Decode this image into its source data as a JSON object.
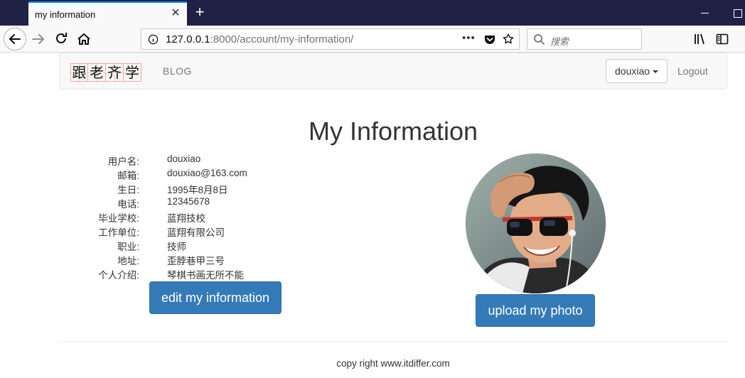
{
  "browser": {
    "tab_title": "my information",
    "url_host": "127.0.0.1",
    "url_rest": ":8000/account/my-information/",
    "search_placeholder": "搜索",
    "page_actions": "•••"
  },
  "site": {
    "logo_chars": [
      "跟",
      "老",
      "齐",
      "学"
    ],
    "nav_blog": "BLOG",
    "user_menu": "douxiao",
    "logout": "Logout"
  },
  "main": {
    "title": "My Information",
    "fields": [
      {
        "label": "用户名:",
        "value": "douxiao"
      },
      {
        "label": "邮箱:",
        "value": "douxiao@163.com"
      },
      {
        "label": "生日:",
        "value": "1995年8月8日"
      },
      {
        "label": "电话:",
        "value": "12345678"
      },
      {
        "label": "毕业学校:",
        "value": "蓝翔技校"
      },
      {
        "label": "工作单位:",
        "value": "蓝翔有限公司"
      },
      {
        "label": "职业:",
        "value": "技师"
      },
      {
        "label": "地址:",
        "value": "歪脖巷甲三号"
      },
      {
        "label": "个人介绍:",
        "value": "琴棋书画无所不能"
      }
    ],
    "edit_button": "edit my information",
    "upload_button": "upload my photo"
  },
  "footer": {
    "text": "copy right www.itdiffer.com"
  },
  "colors": {
    "tabbar_bg": "#1f2145",
    "primary_button": "#337ab7",
    "nav_bg": "#f8f8f8"
  }
}
